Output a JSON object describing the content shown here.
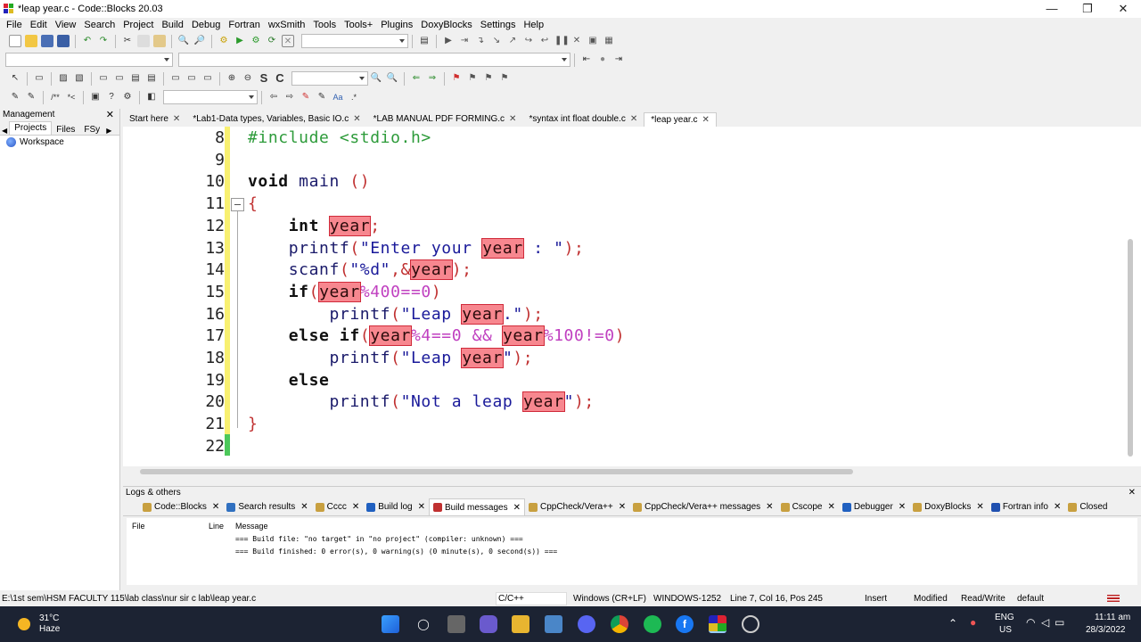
{
  "window": {
    "title": "*leap year.c - Code::Blocks 20.03",
    "controls": [
      "—",
      "❐",
      "✕"
    ]
  },
  "menu": [
    "File",
    "Edit",
    "View",
    "Search",
    "Project",
    "Build",
    "Debug",
    "Fortran",
    "wxSmith",
    "Tools",
    "Tools+",
    "Plugins",
    "DoxyBlocks",
    "Settings",
    "Help"
  ],
  "management": {
    "title": "Management",
    "tabs": [
      "Projects",
      "Files",
      "FSy"
    ],
    "workspace": "Workspace"
  },
  "editor_tabs": [
    {
      "label": "Start here",
      "active": false
    },
    {
      "label": "*Lab1-Data types, Variables, Basic IO.c",
      "active": false
    },
    {
      "label": "*LAB MANUAL PDF FORMING.c",
      "active": false
    },
    {
      "label": "*syntax int float double.c",
      "active": false
    },
    {
      "label": "*leap year.c",
      "active": true
    }
  ],
  "code_lines": [
    {
      "n": "8",
      "html": "<span class='pp'>#include &lt;stdio.h&gt;</span>"
    },
    {
      "n": "9",
      "html": ""
    },
    {
      "n": "10",
      "html": "<span class='kw'>void</span> main <span class='op'>()</span>"
    },
    {
      "n": "11",
      "html": "<span class='op'>{</span>"
    },
    {
      "n": "12",
      "html": "    <span class='kw'>int</span> <span class='hl'>year</span><span class='op'>;</span>"
    },
    {
      "n": "13",
      "html": "    printf<span class='op'>(</span><span class='str'>\"Enter your <span class='hl'>year</span> : \"</span><span class='op'>);</span>"
    },
    {
      "n": "14",
      "html": "    scanf<span class='op'>(</span><span class='str'>\"%d\"</span><span class='op'>,&amp;</span><span class='hl'>year</span><span class='op'>);</span>"
    },
    {
      "n": "15",
      "html": "    <span class='kw'>if</span><span class='op'>(</span><span class='hl'>year</span><span class='num'>%400==0</span><span class='op'>)</span>"
    },
    {
      "n": "16",
      "html": "        printf<span class='op'>(</span><span class='str'>\"Leap <span class='hl'>year</span>.\"</span><span class='op'>);</span>"
    },
    {
      "n": "17",
      "html": "    <span class='kw'>else if</span><span class='op'>(</span><span class='hl'>year</span><span class='num'>%4==0 &amp;&amp; </span><span class='hl'>year</span><span class='num'>%100!=0</span><span class='op'>)</span>"
    },
    {
      "n": "18",
      "html": "        printf<span class='op'>(</span><span class='str'>\"Leap <span class='hl'>year</span>\"</span><span class='op'>);</span>"
    },
    {
      "n": "19",
      "html": "    <span class='kw'>else</span>"
    },
    {
      "n": "20",
      "html": "        printf<span class='op'>(</span><span class='str'>\"Not a leap <span class='hl'>year</span>\"</span><span class='op'>);</span>"
    },
    {
      "n": "21",
      "html": "<span class='op'>}</span>"
    },
    {
      "n": "22",
      "html": ""
    }
  ],
  "logs": {
    "title": "Logs & others",
    "tabs": [
      {
        "label": "Code::Blocks",
        "icon": "document-icon",
        "color": "#c8a040"
      },
      {
        "label": "Search results",
        "icon": "search-icon",
        "color": "#3070c0"
      },
      {
        "label": "Cccc",
        "icon": "document-icon",
        "color": "#c8a040"
      },
      {
        "label": "Build log",
        "icon": "gear-icon",
        "color": "#2060c0"
      },
      {
        "label": "Build messages",
        "icon": "build-icon",
        "color": "#c03030",
        "active": true
      },
      {
        "label": "CppCheck/Vera++",
        "icon": "document-icon",
        "color": "#c8a040"
      },
      {
        "label": "CppCheck/Vera++ messages",
        "icon": "document-icon",
        "color": "#c8a040"
      },
      {
        "label": "Cscope",
        "icon": "document-icon",
        "color": "#c8a040"
      },
      {
        "label": "Debugger",
        "icon": "gear-icon",
        "color": "#2060c0"
      },
      {
        "label": "DoxyBlocks",
        "icon": "document-icon",
        "color": "#c8a040"
      },
      {
        "label": "Fortran info",
        "icon": "fortran-icon",
        "color": "#2050b0"
      },
      {
        "label": "Closed",
        "icon": "document-icon",
        "color": "#c8a040"
      }
    ],
    "columns": [
      "File",
      "Line",
      "Message"
    ],
    "messages": [
      "=== Build file: \"no target\" in \"no project\" (compiler: unknown) ===",
      "=== Build finished: 0 error(s), 0 warning(s) (0 minute(s), 0 second(s)) ==="
    ]
  },
  "status": {
    "path": "E:\\1st sem\\HSM FACULTY 115\\lab class\\nur sir c lab\\leap year.c",
    "language": "C/C++",
    "eol": "Windows (CR+LF)",
    "encoding": "WINDOWS-1252",
    "position": "Line 7, Col 16, Pos 245",
    "mode": "Insert",
    "modified": "Modified",
    "access": "Read/Write",
    "profile": "default"
  },
  "taskbar": {
    "weather_temp": "31°C",
    "weather_desc": "Haze",
    "lang": "ENG",
    "region": "US",
    "time": "11:11 am",
    "date": "28/3/2022"
  }
}
